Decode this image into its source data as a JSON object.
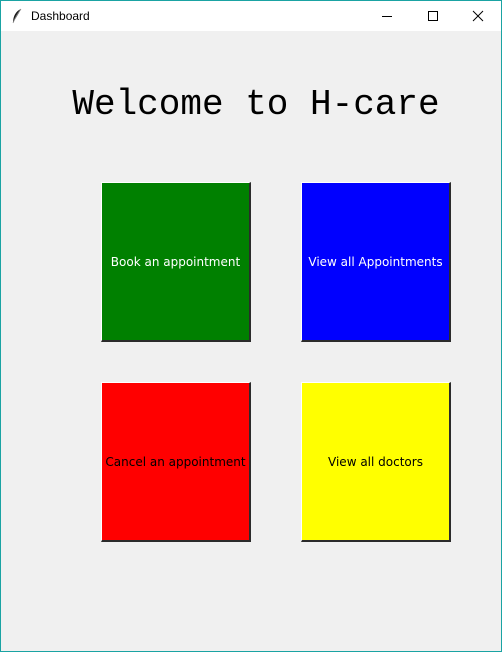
{
  "window": {
    "title": "Dashboard",
    "app_icon": "feather-icon",
    "controls": [
      "minimize-icon",
      "maximize-icon",
      "close-icon"
    ]
  },
  "main": {
    "heading": "Welcome to H-care",
    "tiles": [
      {
        "label": "Book an appointment",
        "color": "#008000",
        "text_color": "#ffffff"
      },
      {
        "label": "View all Appointments",
        "color": "#0000ff",
        "text_color": "#ffffff"
      },
      {
        "label": "Cancel an appointment",
        "color": "#ff0000",
        "text_color": "#000000"
      },
      {
        "label": "View all doctors",
        "color": "#ffff00",
        "text_color": "#000000"
      }
    ]
  },
  "colors": {
    "background": "#f0f0f0",
    "titlebar": "#ffffff",
    "window_border": "#1aa3a3"
  }
}
